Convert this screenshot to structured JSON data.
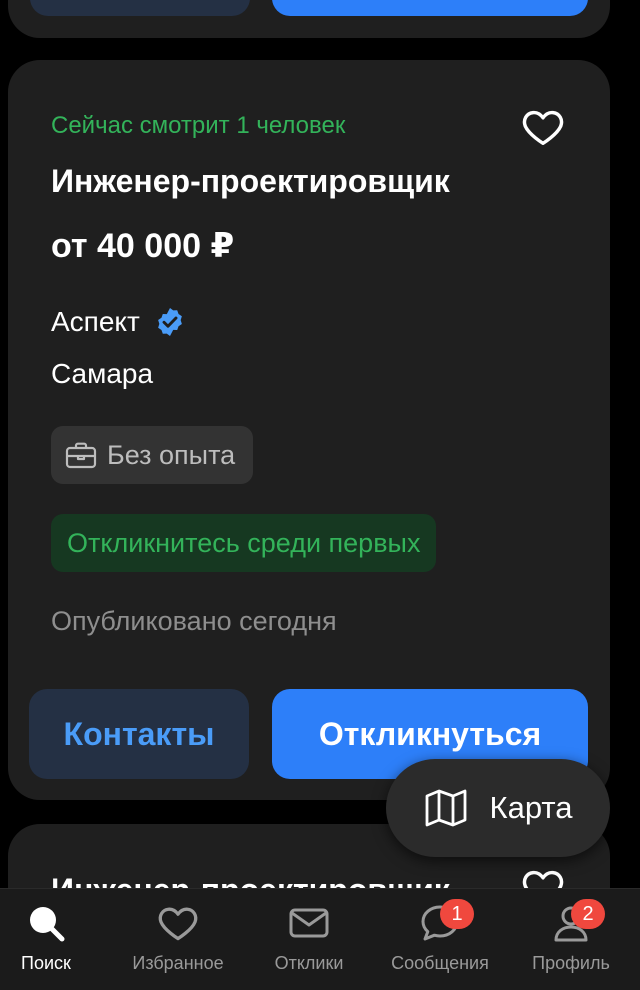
{
  "vacancy": {
    "watching": "Сейчас смотрит 1 человек",
    "title": "Инженер-проектировщик",
    "salary": "от 40 000 ₽",
    "company": "Аспект",
    "city": "Самара",
    "experience": "Без опыта",
    "first_tag": "Откликнитесь среди первых",
    "published": "Опубликовано сегодня",
    "contacts_label": "Контакты",
    "respond_label": "Откликнуться"
  },
  "next_vacancy": {
    "title": "Инженер-проектировщик"
  },
  "map_button": {
    "label": "Карта"
  },
  "tabbar": {
    "search": "Поиск",
    "favorites": "Избранное",
    "responses": "Отклики",
    "messages": "Сообщения",
    "messages_badge": "1",
    "profile": "Профиль",
    "profile_badge": "2"
  },
  "colors": {
    "accent_blue": "#2d7ff9",
    "green": "#33b35a",
    "badge_red": "#f0483e",
    "card_bg": "#1f1f1f"
  },
  "icons": [
    "heart-icon",
    "verified-icon",
    "briefcase-icon",
    "map-icon",
    "search-icon",
    "envelope-icon",
    "chat-bubble-icon",
    "person-icon"
  ]
}
